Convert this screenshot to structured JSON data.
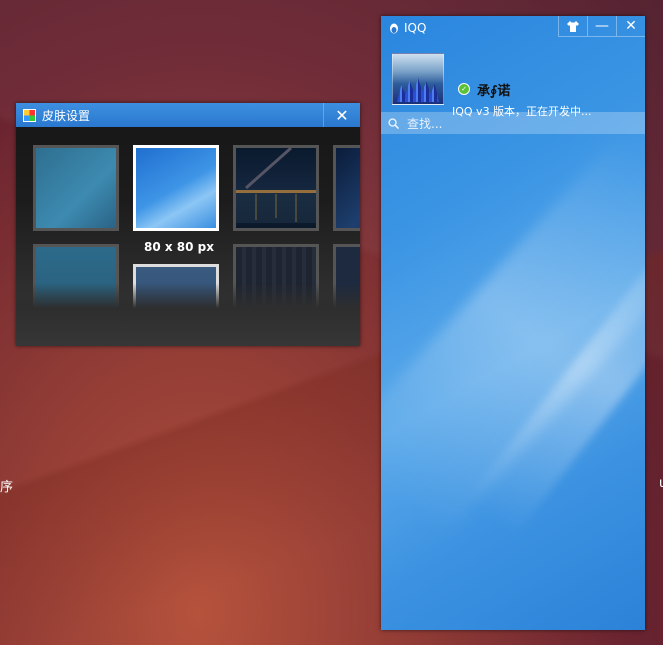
{
  "desktop": {
    "left_text": "序",
    "right_text": "ι"
  },
  "skin_window": {
    "title": "皮肤设置",
    "close_label": "✕",
    "selected_size_label": "80 x 80 px"
  },
  "iqq_window": {
    "title": "IQQ",
    "buttons": {
      "skin": "👕",
      "minimize": "—",
      "close": "✕"
    },
    "profile": {
      "nickname": "承∮诺",
      "status": "online",
      "signature": "IQQ v3 版本，正在开发中..."
    },
    "search": {
      "placeholder": "查找..."
    }
  },
  "colors": {
    "titlebar_blue": "#2a78cf",
    "online_green": "#5bc236"
  }
}
